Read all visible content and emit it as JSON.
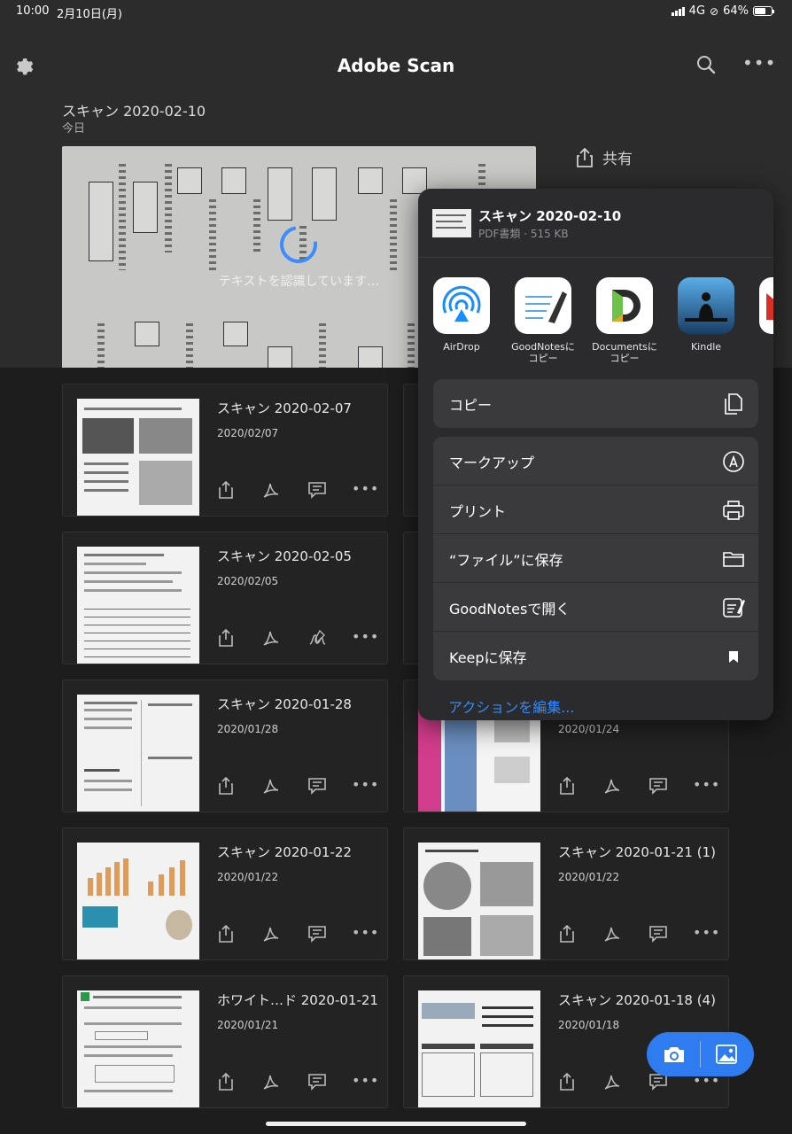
{
  "status_bar": {
    "time": "10:00",
    "date": "2月10日(月)",
    "network": "4G",
    "battery": "64%"
  },
  "header": {
    "title": "Adobe Scan",
    "settings_icon": "gear-icon",
    "search_icon": "search-icon",
    "more_icon": "ellipsis-icon"
  },
  "recent": {
    "title": "スキャン 2020-02-10",
    "subtitle": "今日",
    "share_label": "共有",
    "recognizing_text": "テキストを認識しています…"
  },
  "cards": [
    {
      "title": "スキャン 2020-02-07",
      "date": "2020/02/07"
    },
    {
      "title": "スキャン 2020-02-05",
      "date": "2020/02/05"
    },
    {
      "title": "スキャン 2020-01-28",
      "date": "2020/01/28"
    },
    {
      "title": "",
      "date": "2020/01/24"
    },
    {
      "title": "スキャン 2020-01-22",
      "date": "2020/01/22"
    },
    {
      "title": "スキャン 2020-01-21 (1)",
      "date": "2020/01/22"
    },
    {
      "title": "ホワイト…ド 2020-01-21",
      "date": "2020/01/21"
    },
    {
      "title": "スキャン 2020-01-18 (4)",
      "date": "2020/01/18"
    }
  ],
  "share_sheet": {
    "file_name": "スキャン 2020-02-10",
    "file_meta": "PDF書類 · 515 KB",
    "apps": [
      {
        "label": "AirDrop",
        "icon": "airdrop-icon"
      },
      {
        "label": "GoodNotesに\nコピー",
        "icon": "goodnotes-icon"
      },
      {
        "label": "Documentsに\nコピー",
        "icon": "documents-icon"
      },
      {
        "label": "Kindle",
        "icon": "kindle-icon"
      }
    ],
    "copy_label": "コピー",
    "actions": [
      {
        "label": "マークアップ",
        "icon": "markup-icon"
      },
      {
        "label": "プリント",
        "icon": "printer-icon"
      },
      {
        "label": "“ファイル”に保存",
        "icon": "folder-icon"
      },
      {
        "label": "GoodNotesで開く",
        "icon": "goodnotes-open-icon"
      },
      {
        "label": "Keepに保存",
        "icon": "bookmark-icon"
      }
    ],
    "edit_actions": "アクションを編集..."
  },
  "colors": {
    "accent": "#2F7CF0",
    "link": "#2F8CFF",
    "background": "#1D1D1D",
    "header": "#2C2C2C",
    "sheet": "#2B2B2D"
  }
}
